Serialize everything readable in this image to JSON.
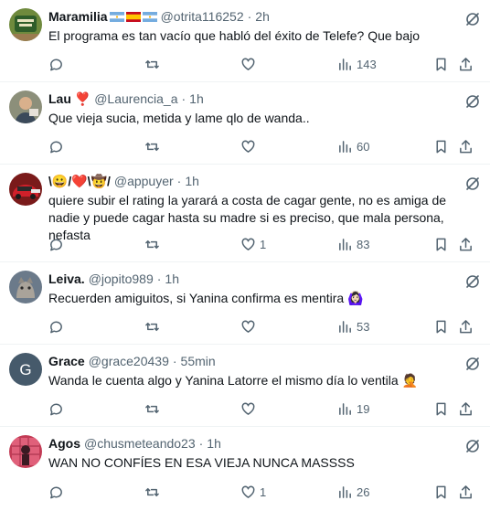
{
  "tweets": [
    {
      "name": "Maramilia",
      "flags": [
        "argentina-flag",
        "spain-flag",
        "argentina-flag"
      ],
      "handle": "@otrita116252",
      "time": "2h",
      "text": "El programa es tan vacío que habló del éxito de Telefe? Que bajo",
      "replies": "",
      "retweets": "",
      "likes": "",
      "views": "143",
      "avatar": "green-sign-avatar"
    },
    {
      "name": "Lau ❣️",
      "handle": "@Laurencia_a",
      "time": "1h",
      "text": "Que vieja sucia, metida y lame qlo de wanda..",
      "replies": "",
      "retweets": "",
      "likes": "",
      "views": "60",
      "avatar": "person-avatar"
    },
    {
      "name": "\\😀/❤️\\🤠/",
      "handle": "@appuyer",
      "time": "1h",
      "text": "quiere subir el rating la yarará a costa de cagar gente, no es amiga de nadie y puede cagar hasta su madre si es preciso, que mala persona, nefasta",
      "replies": "",
      "retweets": "",
      "likes": "1",
      "views": "83",
      "avatar": "red-car-avatar"
    },
    {
      "name": "Leiva.",
      "handle": "@jopito989",
      "time": "1h",
      "text": "Recuerden amiguitos, si Yanina confirma es mentira 🙆🏻‍♀️",
      "replies": "",
      "retweets": "",
      "likes": "",
      "views": "53",
      "avatar": "cat-avatar"
    },
    {
      "name": "Grace",
      "handle": "@grace20439",
      "time": "55min",
      "text": "Wanda le cuenta algo y Yanina Latorre el mismo día lo ventila 🤦",
      "replies": "",
      "retweets": "",
      "likes": "",
      "views": "19",
      "avatar": "letter-avatar",
      "avatar_letter": "G"
    },
    {
      "name": "Agos",
      "handle": "@chusmeteando23",
      "time": "1h",
      "text": "WAN NO CONFÍES EN ESA VIEJA NUNCA MASSSS",
      "replies": "",
      "retweets": "",
      "likes": "1",
      "views": "26",
      "avatar": "pink-photo-avatar"
    }
  ],
  "colors": {
    "text": "#0f1419",
    "secondary": "#536471",
    "divider": "#eff3f4",
    "letter_avatar_bg": "#465a6b"
  }
}
